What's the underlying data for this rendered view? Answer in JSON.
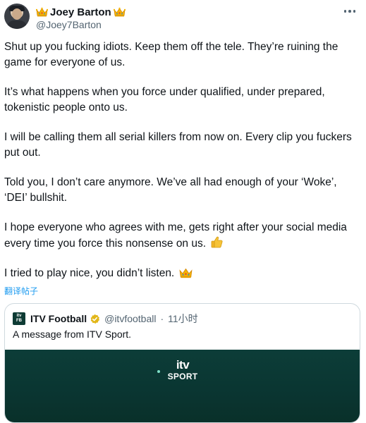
{
  "author": {
    "display_name": "Joey Barton",
    "handle": "@Joey7Barton",
    "left_icon": "crown-emoji-icon",
    "right_icon": "crown-emoji-icon"
  },
  "more_icon": "more-options-icon",
  "tweet": {
    "paragraphs": [
      "Shut up you fucking idiots. Keep them off the tele. They’re ruining the game for everyone of us.",
      "It’s what happens when you force under qualified, under prepared, tokenistic people onto us.",
      "I will be calling them all serial killers from now on. Every clip you fuckers put out.",
      "Told you, I don’t care anymore. We’ve all had enough of your ‘Woke’, ‘DEI’ bullshit.",
      "I hope everyone who agrees with me, gets right after your social media every time you force this nonsense on us.",
      "I tried to play nice, you didn’t listen."
    ],
    "thumbs_up_icon": "thumbs-up-emoji-icon",
    "crown_icon": "crown-emoji-icon"
  },
  "translate_label": "翻译帖子",
  "quote": {
    "name": "ITV Football",
    "handle": "@itvfootball",
    "separator": "·",
    "time": "11小时",
    "verified_icon": "gold-verified-badge-icon",
    "logo_text": "itv FOOTBALL",
    "text": "A message from ITV Sport.",
    "media": {
      "logo_top": "itv",
      "logo_bottom": "SPORT",
      "background_color": "#0c3d38"
    }
  },
  "colors": {
    "link": "#1d9bf0",
    "secondary_text": "#536471",
    "primary_text": "#0f1419",
    "border": "#cfd9de"
  }
}
